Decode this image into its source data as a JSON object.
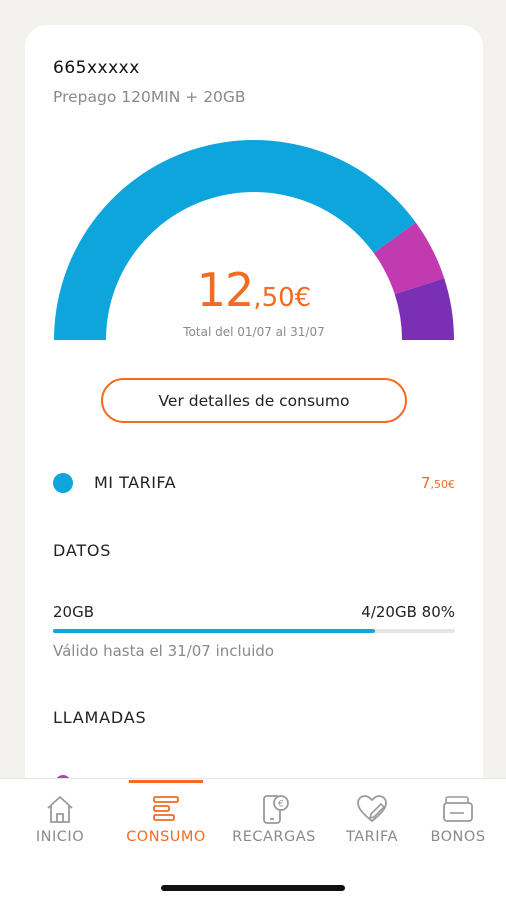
{
  "account": {
    "phone_number": "665xxxxx",
    "plan_name": "Prepago 120MIN + 20GB"
  },
  "gauge": {
    "amount_integer": "12",
    "amount_decimal": ",50€",
    "period_text": "Total del 01/07 al 31/07",
    "segments": [
      {
        "color": "#0ea5dd",
        "fraction": 0.8
      },
      {
        "color": "#c23ab0",
        "fraction": 0.1
      },
      {
        "color": "#7b2fb5",
        "fraction": 0.1
      }
    ]
  },
  "details_button_label": "Ver detalles de consumo",
  "tariff": {
    "label": "MI TARIFA",
    "price_integer": "7",
    "price_decimal": ",50€",
    "dot_color": "#0ea5dd"
  },
  "datos": {
    "title": "DATOS",
    "name": "20GB",
    "usage": "4/20GB 80%",
    "progress_fraction": 0.8,
    "valid_until": "Válido hasta el 31/07 incluido"
  },
  "llamadas": {
    "title": "LLAMADAS"
  },
  "tabbar": {
    "items": [
      {
        "label": "INICIO",
        "icon": "home-icon",
        "active": false
      },
      {
        "label": "CONSUMO",
        "icon": "consumption-bars-icon",
        "active": true
      },
      {
        "label": "RECARGAS",
        "icon": "phone-euro-icon",
        "active": false
      },
      {
        "label": "TARIFA",
        "icon": "heart-pen-icon",
        "active": false
      },
      {
        "label": "BONOS",
        "icon": "wallet-icon",
        "active": false
      }
    ]
  },
  "colors": {
    "accent": "#f26b21",
    "blue": "#0ea5dd",
    "magenta": "#c23ab0",
    "purple": "#7b2fb5"
  }
}
